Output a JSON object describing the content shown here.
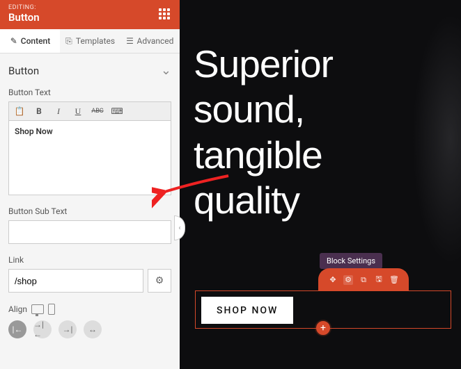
{
  "colors": {
    "accent": "#d6492a"
  },
  "header": {
    "editing_label": "EDITING:",
    "element_name": "Button"
  },
  "tabs": {
    "content": "Content",
    "templates": "Templates",
    "advanced": "Advanced"
  },
  "section": {
    "title": "Button"
  },
  "fields": {
    "button_text": {
      "label": "Button Text",
      "value": "Shop Now"
    },
    "button_sub_text": {
      "label": "Button Sub Text",
      "value": ""
    },
    "link": {
      "label": "Link",
      "value": "/shop"
    },
    "align": {
      "label": "Align"
    }
  },
  "preview": {
    "hero_line1": "Superior",
    "hero_line2": "sound,",
    "hero_line3": "tangible",
    "hero_line4": "quality",
    "button_label": "SHOP NOW",
    "tooltip": "Block Settings"
  },
  "icons": {
    "pencil": "✎",
    "template": "⎘",
    "sliders": "☰",
    "clipboard": "📋",
    "bold": "B",
    "italic": "I",
    "underline": "U",
    "strike": "ABC",
    "keyboard": "⌨",
    "gear": "⚙",
    "chevron_down": "⌄",
    "chevron_left": "‹",
    "move": "✥",
    "duplicate": "⧉",
    "save": "🖫",
    "delete": "🗑",
    "plus": "+"
  }
}
